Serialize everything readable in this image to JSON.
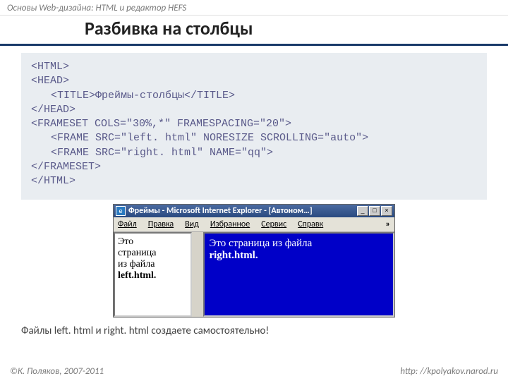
{
  "topbar": "Основы Web-дизайна: HTML и редактор HEFS",
  "title": "Разбивка на столбцы",
  "code": {
    "l1": "<HTML>",
    "l2": "<HEAD>",
    "l3": "<TITLE>Фреймы-столбцы</TITLE>",
    "l4": "</HEAD>",
    "l5": "<FRAMESET COLS=\"30%,*\" FRAMESPACING=\"20\">",
    "l6": "<FRAME SRC=\"left. html\" NORESIZE SCROLLING=\"auto\">",
    "l7": "<FRAME SRC=\"right. html\" NAME=\"qq\">",
    "l8": "</FRAMESET>",
    "l9": "</HTML>"
  },
  "browser": {
    "wtitle": "Фреймы - Microsoft Internet Explorer - [Автоном…]",
    "min": "_",
    "max": "□",
    "close": "×",
    "menu": {
      "m1": "Файл",
      "m2": "Правка",
      "m3": "Вид",
      "m4": "Избранное",
      "m5": "Сервис",
      "m6": "Справк",
      "more": "»"
    },
    "left": {
      "p1": "Это",
      "p2": "страница",
      "p3": "из файла",
      "p4": "left.html."
    },
    "right": {
      "p1": "Это страница из файла",
      "p2": "right.html."
    }
  },
  "note": "Файлы left. html и right. html создаете самостоятельно!",
  "footer": {
    "left": "©К. Поляков, 2007-2011",
    "right": "http: //kpolyakov.narod.ru"
  }
}
